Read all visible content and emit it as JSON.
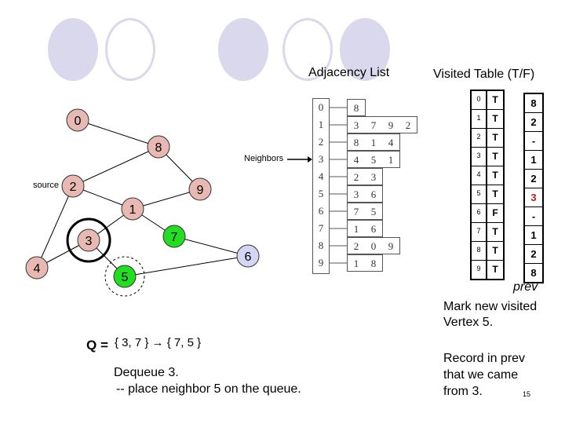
{
  "decorations": [
    "filled-oval",
    "ring-oval",
    "filled-oval",
    "ring-oval",
    "filled-oval"
  ],
  "titles": {
    "adjacency": "Adjacency List",
    "visited": "Visited Table (T/F)"
  },
  "neighbors_label": "Neighbors",
  "source_label": "source",
  "graph": {
    "nodes": [
      {
        "id": "0",
        "state": "visited",
        "color": "#e8b8b2"
      },
      {
        "id": "8",
        "state": "visited",
        "color": "#e8b8b2"
      },
      {
        "id": "2",
        "state": "visited",
        "color": "#e8b8b2"
      },
      {
        "id": "9",
        "state": "visited",
        "color": "#e8b8b2"
      },
      {
        "id": "1",
        "state": "visited",
        "color": "#e8b8b2"
      },
      {
        "id": "3",
        "state": "current",
        "color": "#e8b8b2"
      },
      {
        "id": "7",
        "state": "queued",
        "color": "#22dd22"
      },
      {
        "id": "6",
        "state": "unvisited",
        "color": "#d4d6f4"
      },
      {
        "id": "4",
        "state": "visited",
        "color": "#e8b8b2"
      },
      {
        "id": "5",
        "state": "queued-new",
        "color": "#22dd22"
      }
    ],
    "edges": [
      [
        "0",
        "8"
      ],
      [
        "8",
        "2"
      ],
      [
        "8",
        "9"
      ],
      [
        "2",
        "1"
      ],
      [
        "1",
        "9"
      ],
      [
        "2",
        "4"
      ],
      [
        "1",
        "3"
      ],
      [
        "1",
        "7"
      ],
      [
        "3",
        "4"
      ],
      [
        "3",
        "5"
      ],
      [
        "7",
        "6"
      ],
      [
        "5",
        "6"
      ]
    ]
  },
  "adjacency_list": [
    {
      "index": "0",
      "neighbors": [
        "8"
      ]
    },
    {
      "index": "1",
      "neighbors": [
        "3",
        "7",
        "9",
        "2"
      ]
    },
    {
      "index": "2",
      "neighbors": [
        "8",
        "1",
        "4"
      ]
    },
    {
      "index": "3",
      "neighbors": [
        "4",
        "5",
        "1"
      ]
    },
    {
      "index": "4",
      "neighbors": [
        "2",
        "3"
      ]
    },
    {
      "index": "5",
      "neighbors": [
        "3",
        "6"
      ]
    },
    {
      "index": "6",
      "neighbors": [
        "7",
        "5"
      ]
    },
    {
      "index": "7",
      "neighbors": [
        "1",
        "6"
      ]
    },
    {
      "index": "8",
      "neighbors": [
        "2",
        "0",
        "9"
      ]
    },
    {
      "index": "9",
      "neighbors": [
        "1",
        "8"
      ]
    }
  ],
  "visited_table": [
    {
      "index": "0",
      "value": "T"
    },
    {
      "index": "1",
      "value": "T"
    },
    {
      "index": "2",
      "value": "T"
    },
    {
      "index": "3",
      "value": "T"
    },
    {
      "index": "4",
      "value": "T"
    },
    {
      "index": "5",
      "value": "T"
    },
    {
      "index": "6",
      "value": "F"
    },
    {
      "index": "7",
      "value": "T"
    },
    {
      "index": "8",
      "value": "T"
    },
    {
      "index": "9",
      "value": "T"
    }
  ],
  "prev_table": [
    {
      "value": "8"
    },
    {
      "value": "2"
    },
    {
      "value": "-"
    },
    {
      "value": "1"
    },
    {
      "value": "2"
    },
    {
      "value": "3",
      "highlight": "#b22222"
    },
    {
      "value": "-"
    },
    {
      "value": "1"
    },
    {
      "value": "2"
    },
    {
      "value": "8"
    }
  ],
  "prev_label": "prev",
  "queue": {
    "label": "Q =",
    "text": "{ 3, 7 } → { 7, 5 }"
  },
  "notes": {
    "dequeue": "Dequeue 3.",
    "place": "-- place neighbor 5 on the queue.",
    "mark_1": "Mark new visited",
    "mark_2": "Vertex 5.",
    "record_1": "Record in prev",
    "record_2": "that we came",
    "record_3": "from 3."
  },
  "page_number": "15"
}
